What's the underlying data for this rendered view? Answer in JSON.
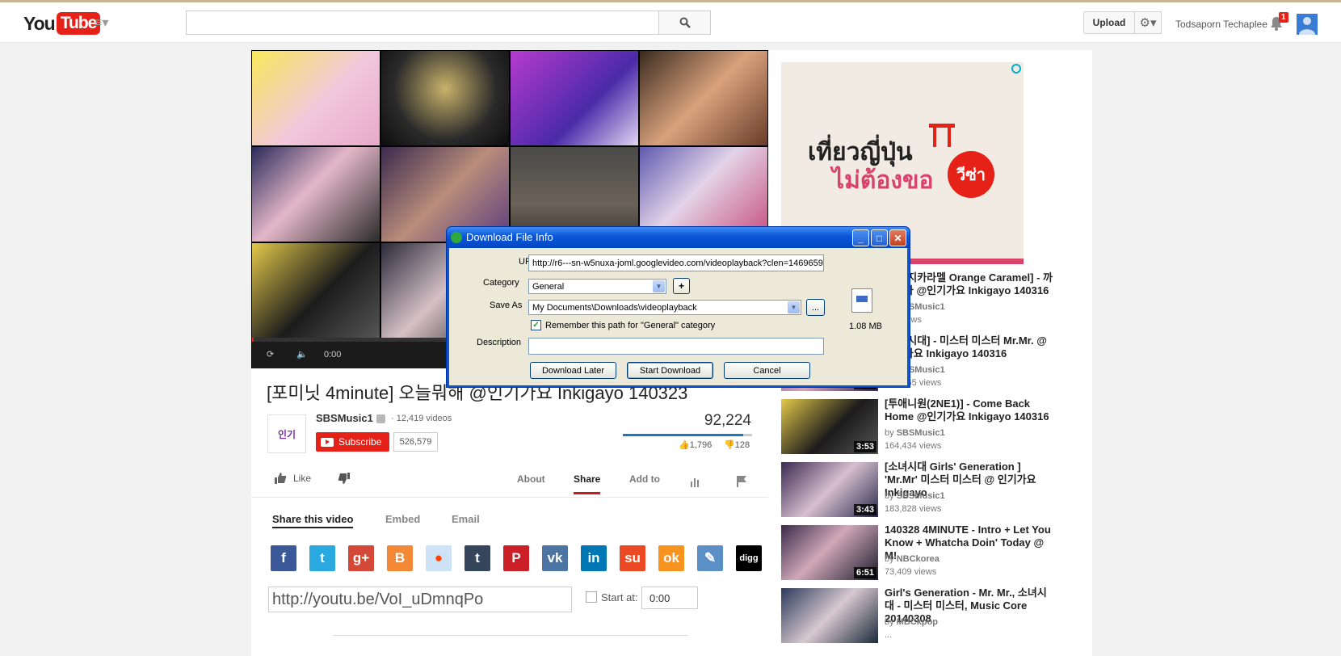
{
  "masthead": {
    "logo_you": "You",
    "logo_tube": "Tube",
    "search_placeholder": "",
    "upload_label": "Upload",
    "username": "Todsaporn Techaplee",
    "notification_count": "1"
  },
  "player": {
    "time": "0:00"
  },
  "video": {
    "title": "[포미닛 4minute] 오늘뭐해 @인기가요 Inkigayo 140323",
    "channel_name": "SBSMusic1",
    "video_count": "· 12,419 videos",
    "subscribe_label": "Subscribe",
    "subscriber_count": "526,579",
    "view_count": "92,224",
    "likes": "1,796",
    "dislikes": "128",
    "like_ratio": 0.93,
    "like_label": "Like"
  },
  "tabs": [
    "About",
    "Share",
    "Add to"
  ],
  "share": {
    "tabs": [
      "Share this video",
      "Embed",
      "Email"
    ],
    "url": "http://youtu.be/VoI_uDmnqPo",
    "start_at_label": "Start at:",
    "start_at_value": "0:00",
    "socials": [
      {
        "name": "facebook",
        "glyph": "f",
        "color": "#3b5998"
      },
      {
        "name": "twitter",
        "glyph": "t",
        "color": "#2aa9e0"
      },
      {
        "name": "google-plus",
        "glyph": "g+",
        "color": "#d34836"
      },
      {
        "name": "blogger",
        "glyph": "B",
        "color": "#f38936"
      },
      {
        "name": "reddit",
        "glyph": "●",
        "color": "#cee3f8"
      },
      {
        "name": "tumblr",
        "glyph": "t",
        "color": "#35465c"
      },
      {
        "name": "pinterest",
        "glyph": "P",
        "color": "#cb2027"
      },
      {
        "name": "vk",
        "glyph": "vk",
        "color": "#4c75a3"
      },
      {
        "name": "linkedin",
        "glyph": "in",
        "color": "#0077b5"
      },
      {
        "name": "stumbleupon",
        "glyph": "su",
        "color": "#eb4924"
      },
      {
        "name": "odnoklassniki",
        "glyph": "ok",
        "color": "#f7931e"
      },
      {
        "name": "livejournal",
        "glyph": "✎",
        "color": "#5d8fc7"
      },
      {
        "name": "digg",
        "glyph": "digg",
        "color": "#000000"
      }
    ]
  },
  "ad": {
    "line1": "เที่ยวญี่ปุ่น",
    "line2": "ไม่ต้องขอ",
    "badge": "วีซ่า"
  },
  "related": [
    {
      "title": "[오렌지카라멜 Orange Caramel] - 까탈레나 @인기가요 Inkigayo 140316",
      "by": "SBSMusic1",
      "views": "...2 views",
      "duration": ""
    },
    {
      "title": "[소녀시대] - 미스터 미스터 Mr.Mr. @인기가요 Inkigayo 140316",
      "by": "SBSMusic1",
      "views": "340,065 views",
      "duration": "3:54"
    },
    {
      "title": "[투애니원(2NE1)] - Come Back Home @인기가요 Inkigayo 140316",
      "by": "SBSMusic1",
      "views": "164,434 views",
      "duration": "3:53"
    },
    {
      "title": "[소녀시대 Girls' Generation ] 'Mr.Mr' 미스터 미스터 @ 인기가요 Inkigayo",
      "by": "SBSMusic1",
      "views": "183,828 views",
      "duration": "3:43"
    },
    {
      "title": "140328 4MINUTE - Intro + Let You Know + Whatcha Doin' Today @ M!",
      "by": "NBCkorea",
      "views": "73,409 views",
      "duration": "6:51"
    },
    {
      "title": "Girl's Generation - Mr. Mr., 소녀시대 - 미스터 미스터, Music Core 20140308",
      "by": "MBCkpop",
      "views": "...",
      "duration": ""
    }
  ],
  "dialog": {
    "title": "Download File Info",
    "url_label": "URL",
    "url_value": "http://r6---sn-w5nuxa-joml.googlevideo.com/videoplayback?clen=1469659",
    "category_label": "Category",
    "category_value": "General",
    "save_as_label": "Save As",
    "save_as_value": "My Documents\\Downloads\\videoplayback",
    "remember_label": "Remember this path for \"General\" category",
    "remember_checked": true,
    "description_label": "Description",
    "description_value": "",
    "file_size": "1.08  MB",
    "download_later": "Download Later",
    "start_download": "Start Download",
    "cancel": "Cancel",
    "add_glyph": "+",
    "browse_glyph": "..."
  }
}
